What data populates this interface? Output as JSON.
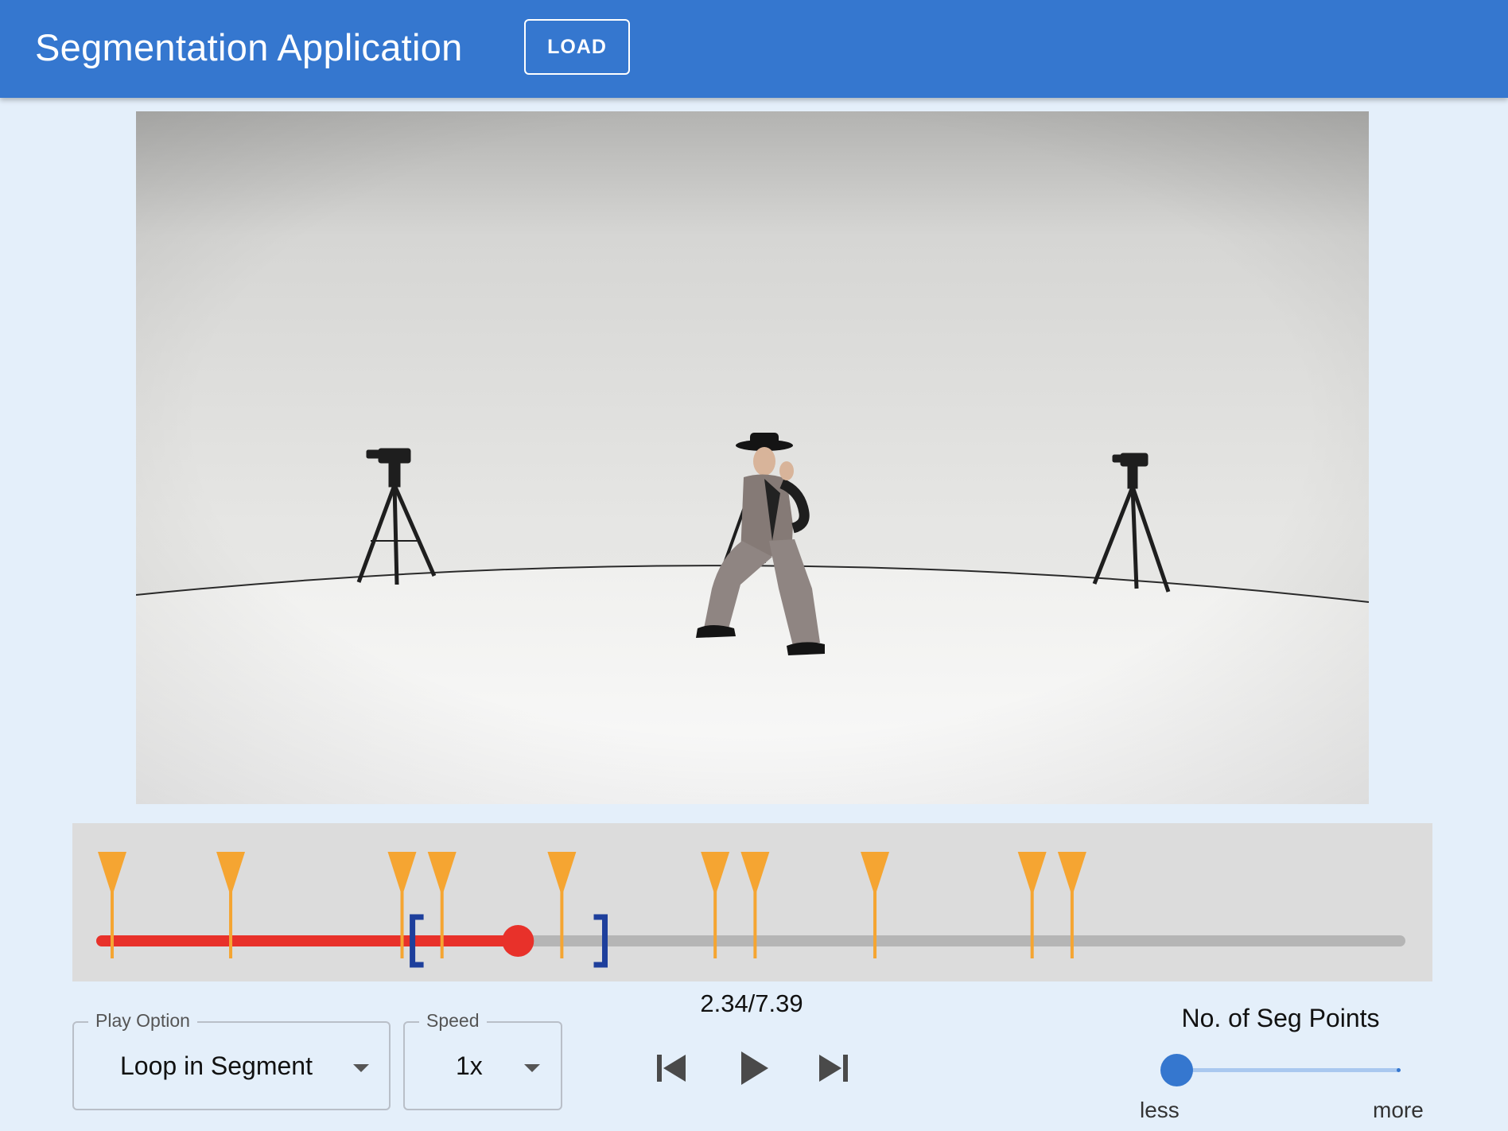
{
  "app": {
    "title": "Segmentation Application",
    "load_label": "LOAD"
  },
  "colors": {
    "appbar": "#3577cf",
    "page_bg": "#e4effa",
    "progress": "#e8312a",
    "marker": "#f5a532",
    "bracket": "#1e3f9c",
    "track": "#b5b5b5"
  },
  "timeline": {
    "current_time": 2.34,
    "duration": 7.39,
    "readout": "2.34/7.39",
    "progress_fraction": 0.315,
    "segment_start_fraction": 0.23,
    "segment_end_fraction": 0.375,
    "seg_point_fractions": [
      0.0,
      0.092,
      0.225,
      0.256,
      0.349,
      0.468,
      0.499,
      0.592,
      0.714,
      0.745
    ]
  },
  "play_option": {
    "label": "Play Option",
    "value": "Loop in Segment"
  },
  "speed": {
    "label": "Speed",
    "value": "1x"
  },
  "controls": {
    "skip_back_icon": "skip-previous-icon",
    "play_icon": "play-icon",
    "skip_forward_icon": "skip-next-icon"
  },
  "seg_points": {
    "title": "No. of Seg Points",
    "min_label": "less",
    "max_label": "more",
    "value_fraction": 0.0
  }
}
